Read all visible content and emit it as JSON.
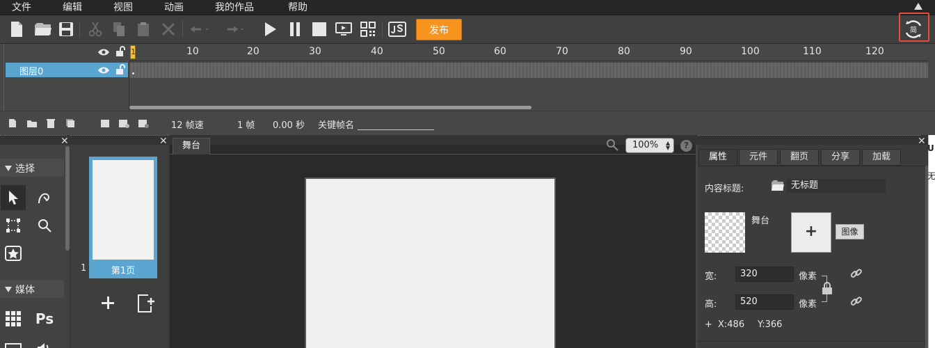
{
  "menu": {
    "items": [
      "文件",
      "编辑",
      "视图",
      "动画",
      "我的作品",
      "帮助"
    ]
  },
  "toolbar": {
    "publish_label": "发布",
    "sync_icon_label": "简"
  },
  "timeline": {
    "ticks": [
      "10",
      "20",
      "30",
      "40",
      "50",
      "60",
      "70",
      "80",
      "90",
      "100",
      "110",
      "120"
    ],
    "playhead_label": "1",
    "layer_name": "图层0",
    "fps_text": "12 帧速",
    "frame_text": "1 帧",
    "time_text": "0.00 秒",
    "keyframe_label": "关键帧名"
  },
  "tools": {
    "select_header": "选择",
    "media_header": "媒体",
    "ps_label": "Ps"
  },
  "pages": {
    "page_number": "1",
    "page_label": "第1页"
  },
  "stage": {
    "tab_label": "舞台",
    "zoom_value": "100%",
    "help_label": "?"
  },
  "props": {
    "tabs": [
      "属性",
      "元件",
      "翻页",
      "分享",
      "加载"
    ],
    "content_title_label": "内容标题:",
    "content_title_value": "无标题",
    "stage_label": "舞台",
    "add_image_symbol": "+",
    "image_button": "图像",
    "width_label": "宽:",
    "width_value": "320",
    "height_label": "高:",
    "height_value": "520",
    "unit_label": "像素",
    "x_label": "X:486",
    "y_label": "Y:366",
    "plus_symbol": "+"
  },
  "edge": {
    "letter_u": "U",
    "letter_wu": "无"
  }
}
